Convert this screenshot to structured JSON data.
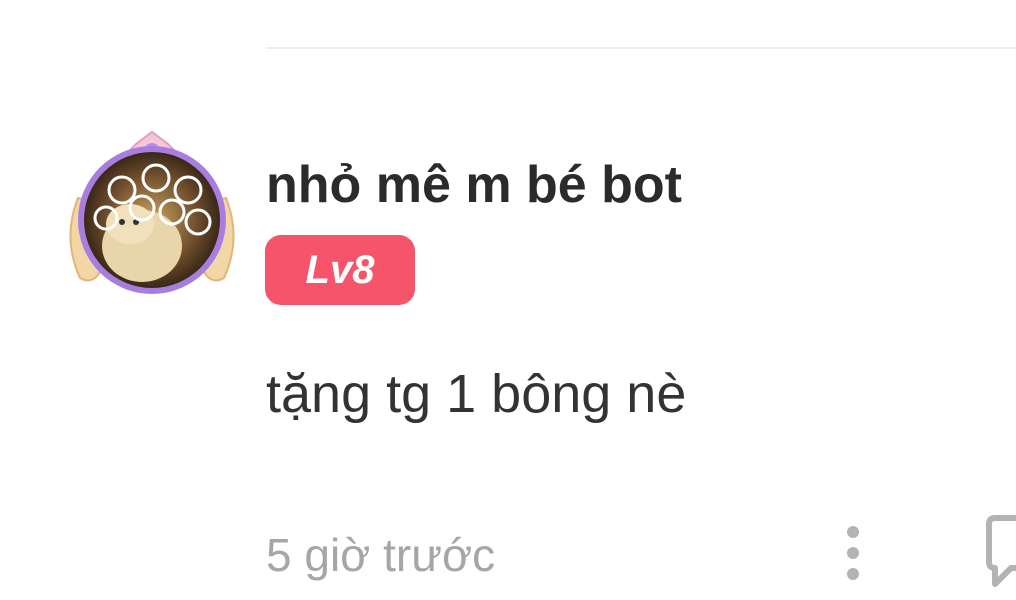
{
  "comment": {
    "username": "nhỏ mê m bé bot",
    "level_badge": "Lv8",
    "text": "tặng tg 1 bông nè",
    "timestamp": "5 giờ trước"
  },
  "icons": {
    "more": "more-vertical-icon",
    "reply": "comment-icon"
  },
  "colors": {
    "badge": "#f6546a",
    "username": "#2b2b2b",
    "timestamp": "#a6a6a6"
  }
}
